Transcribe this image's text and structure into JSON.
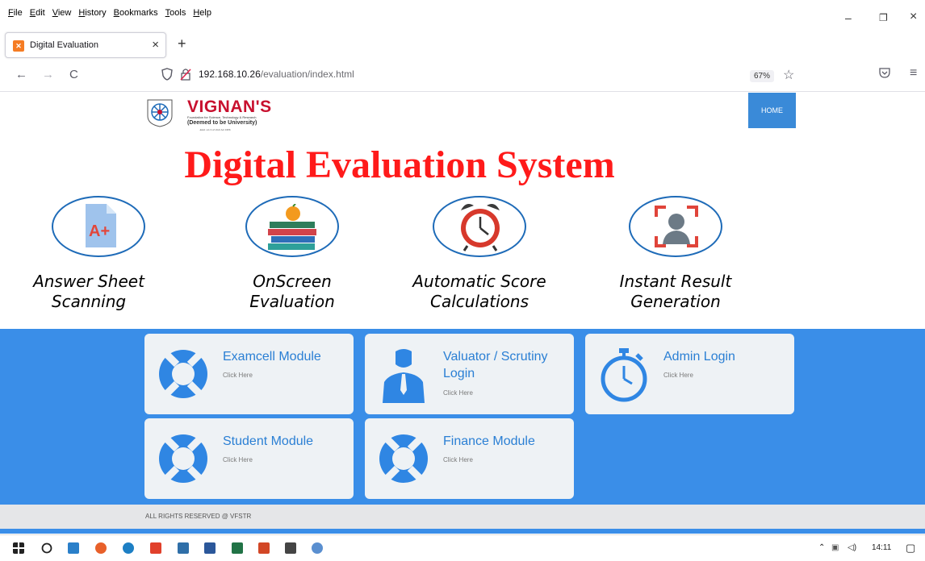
{
  "menubar": {
    "items": [
      "File",
      "Edit",
      "View",
      "History",
      "Bookmarks",
      "Tools",
      "Help"
    ]
  },
  "window_controls": {
    "minimize": "–",
    "restore": "❐",
    "close": "×"
  },
  "tab": {
    "title": "Digital Evaluation",
    "close": "×",
    "new_tab": "+"
  },
  "navbar": {
    "back": "←",
    "forward": "→",
    "reload": "C",
    "url_host": "192.168.10.26",
    "url_path": "/evaluation/index.html",
    "zoom": "67%"
  },
  "page": {
    "logo": {
      "name": "VIGNAN'S",
      "sub1": "Foundation for Science, Technology & Research",
      "sub2": "(Deemed to be University)",
      "sub3": "-Estd. u/s 3 of UGC Act 1956"
    },
    "home_button": "HOME",
    "headline": "Digital Evaluation System",
    "features": [
      {
        "line1": "Answer Sheet",
        "line2": "Scanning",
        "icon": "a-plus-document-icon"
      },
      {
        "line1": "OnScreen",
        "line2": "Evaluation",
        "icon": "books-apple-icon"
      },
      {
        "line1": "Automatic Score",
        "line2": "Calculations",
        "icon": "alarm-clock-icon"
      },
      {
        "line1": "Instant Result",
        "line2": "Generation",
        "icon": "face-scan-icon"
      }
    ],
    "cards": [
      {
        "title": "Examcell Module",
        "sub": "Click Here",
        "icon": "lifebuoy-icon"
      },
      {
        "title": "Valuator / Scrutiny Login",
        "sub": "Click Here",
        "icon": "person-icon"
      },
      {
        "title": "Admin Login",
        "sub": "Click Here",
        "icon": "stopwatch-icon"
      },
      {
        "title": "Student Module",
        "sub": "Click Here",
        "icon": "lifebuoy-icon"
      },
      {
        "title": "Finance Module",
        "sub": "Click Here",
        "icon": "lifebuoy-icon"
      }
    ],
    "footer": "ALL RIGHTS RESERVED @ VFSTR"
  },
  "taskbar": {
    "time": "14:11"
  },
  "colors": {
    "band": "#3a8ee8",
    "headline": "#ff1a1a",
    "card_title": "#2a7fd4",
    "home": "#3a8ad8"
  }
}
